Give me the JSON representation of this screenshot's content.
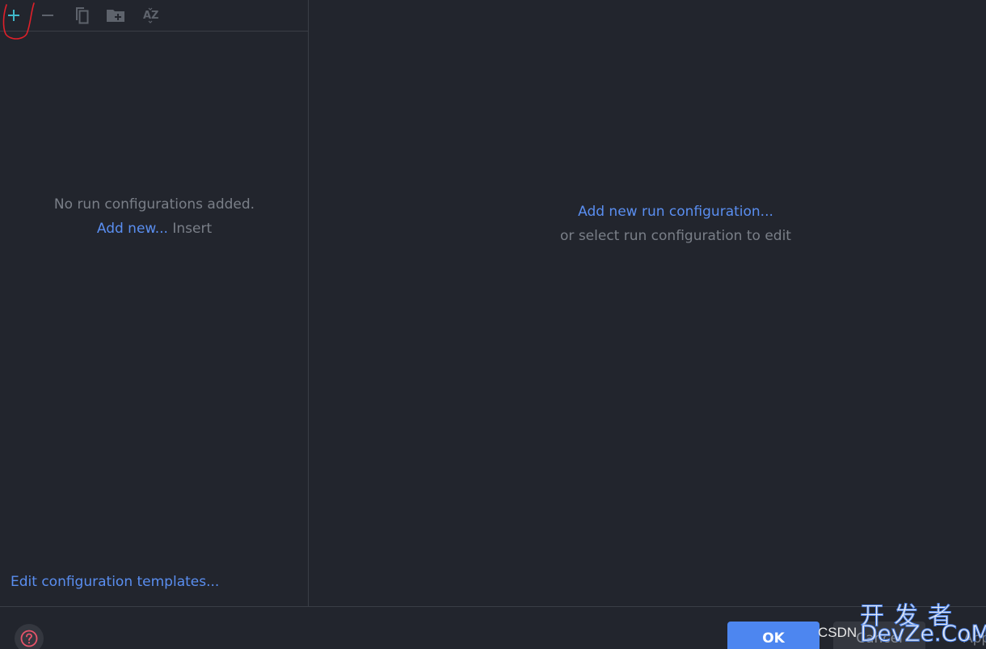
{
  "toolbar": {
    "add_icon": "plus-icon",
    "remove_icon": "minus-icon",
    "copy_icon": "copy-icon",
    "folder_icon": "new-folder-icon",
    "sort_icon": "sort-alphabetically-icon",
    "sort_label": "AZ"
  },
  "left_panel": {
    "empty_message": "No run configurations added.",
    "add_new_link": "Add new...",
    "add_new_shortcut": "Insert",
    "templates_link": "Edit configuration templates..."
  },
  "right_panel": {
    "add_link": "Add new run configuration...",
    "hint": "or select run configuration to edit"
  },
  "footer": {
    "help_icon": "help-icon",
    "ok_label": "OK",
    "cancel_label": "Cancel",
    "apply_label": "Apply"
  },
  "watermark": {
    "small": "CSDN",
    "chinese": "开发者",
    "english": "DevZe.CoM"
  },
  "colors": {
    "background": "#22252d",
    "link": "#5a8ef0",
    "primary_button": "#4d86f0",
    "annotation": "#e0202a"
  }
}
